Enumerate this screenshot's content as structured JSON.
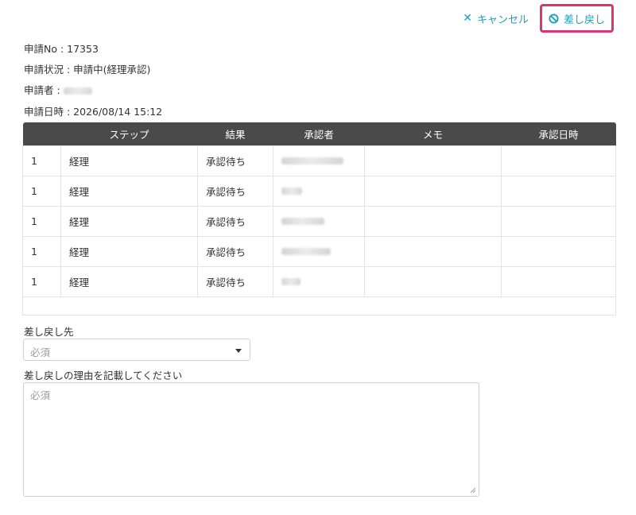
{
  "toolbar": {
    "cancel_label": "キャンセル",
    "sendback_label": "差し戻し"
  },
  "info": {
    "request_no": "申請No : 17353",
    "status": "申請状況 : 申請中(経理承認)",
    "applicant_label": "申請者 :",
    "datetime": "申請日時 : 2026/08/14 15:12"
  },
  "table": {
    "headers": [
      "",
      "ステップ",
      "結果",
      "承認者",
      "メモ",
      "承認日時"
    ],
    "rows": [
      {
        "step": "1",
        "dept": "経理",
        "result": "承認待ち"
      },
      {
        "step": "1",
        "dept": "経理",
        "result": "承認待ち"
      },
      {
        "step": "1",
        "dept": "経理",
        "result": "承認待ち"
      },
      {
        "step": "1",
        "dept": "経理",
        "result": "承認待ち"
      },
      {
        "step": "1",
        "dept": "経理",
        "result": "承認待ち"
      }
    ]
  },
  "form": {
    "target_label": "差し戻し先",
    "target_placeholder": "必須",
    "reason_label": "差し戻しの理由を記載してください",
    "reason_placeholder": "必須"
  },
  "colors": {
    "accent": "#17a2b8",
    "highlight": "#e0336f",
    "header_bg": "#4a4a4a"
  }
}
